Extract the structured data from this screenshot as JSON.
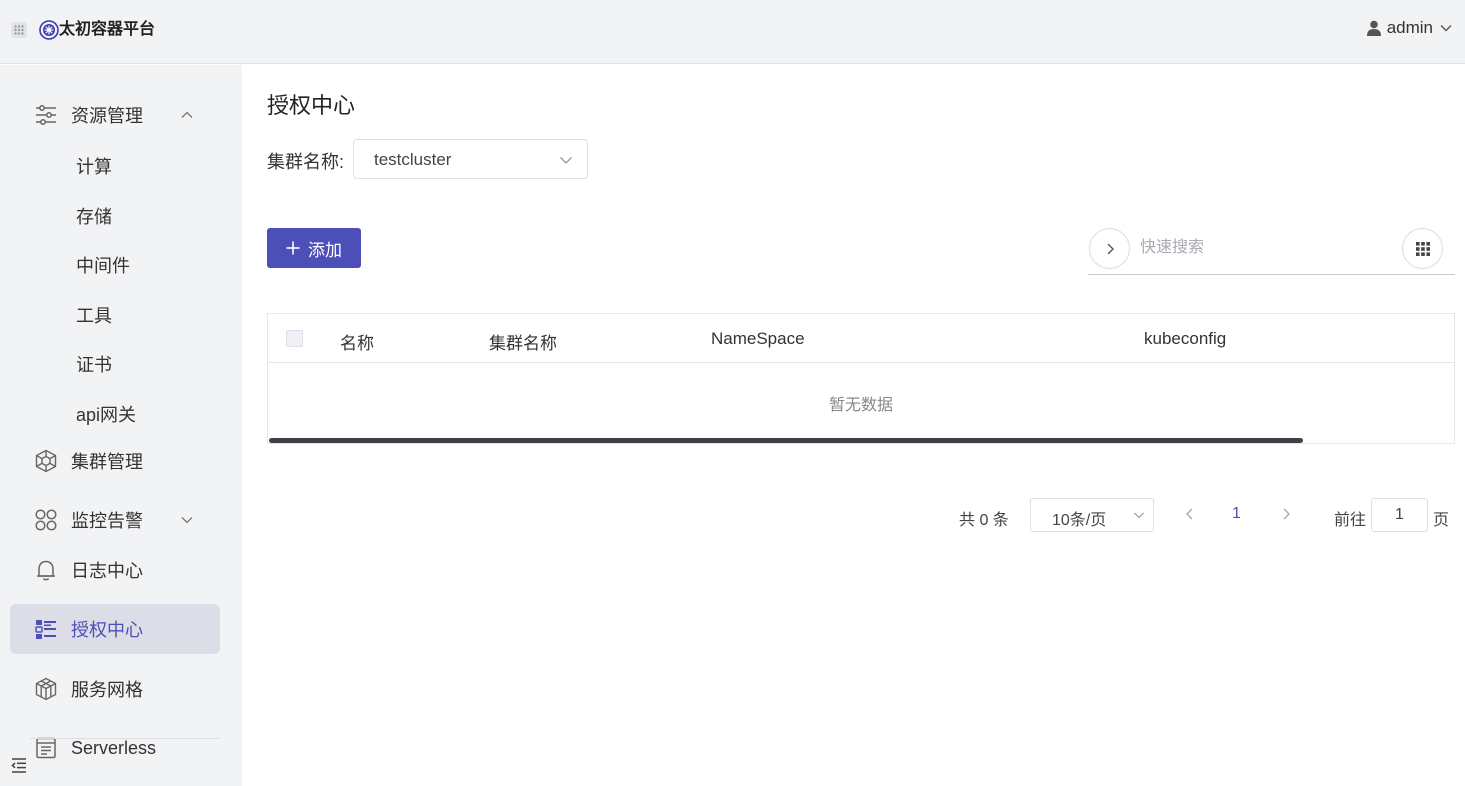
{
  "header": {
    "brand": "太初容器平台",
    "user": "admin"
  },
  "sidebar": {
    "resource": {
      "label": "资源管理",
      "icon": "sliders-icon"
    },
    "sub_items": [
      "计算",
      "存储",
      "中间件",
      "工具",
      "证书",
      "api网关"
    ],
    "items": [
      {
        "label": "集群管理",
        "icon": "cluster-helm-icon"
      },
      {
        "label": "监控告警",
        "icon": "apps-circles-icon"
      },
      {
        "label": "日志中心",
        "icon": "bell-icon"
      },
      {
        "label": "授权中心",
        "icon": "list-check-icon",
        "active": true
      },
      {
        "label": "服务网格",
        "icon": "cube-mesh-icon"
      },
      {
        "label": "Serverless",
        "icon": "document-panel-icon"
      }
    ]
  },
  "main": {
    "title": "授权中心",
    "filter": {
      "label": "集群名称:",
      "value": "testcluster"
    },
    "add_button": "添加",
    "search": {
      "placeholder": "快速搜索"
    },
    "table": {
      "columns": [
        "名称",
        "集群名称",
        "NameSpace",
        "kubeconfig"
      ],
      "rows": [],
      "empty_text": "暂无数据"
    },
    "pagination": {
      "total_text": "共 0 条",
      "page_size": "10条/页",
      "current_page": "1",
      "goto_label": "前往",
      "goto_value": "1",
      "page_unit": "页"
    }
  },
  "colors": {
    "accent": "#4d4fb8",
    "sidebar_bg": "#f2f3f5",
    "active_bg": "#dcdde6"
  }
}
